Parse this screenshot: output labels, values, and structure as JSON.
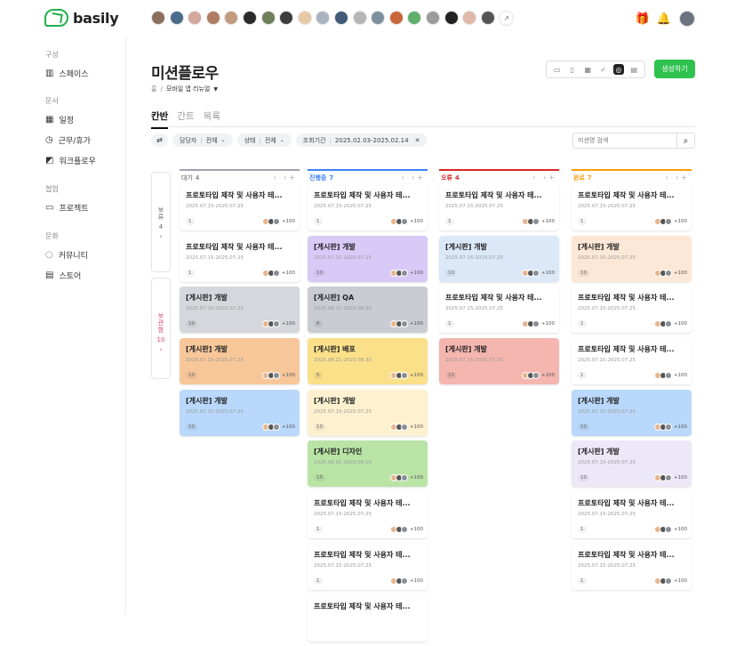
{
  "app": {
    "name": "basily"
  },
  "header": {
    "avatar_colors": [
      "#8b6f5c",
      "#4a6b8a",
      "#d4a89c",
      "#b07d62",
      "#c49a7e",
      "#2b2b2b",
      "#6e7f5a",
      "#3d3d3d",
      "#e8c9a6",
      "#aab4c0",
      "#405a78",
      "#b6b6b6",
      "#7b8f9c",
      "#c8663a",
      "#5fae6c",
      "#9c9c9c",
      "#222",
      "#e0b8a8",
      "#555"
    ]
  },
  "sidebar": {
    "sections": [
      {
        "label": "구성",
        "items": [
          {
            "label": "스페이스",
            "icon": "building-icon"
          }
        ]
      },
      {
        "label": "문서",
        "items": [
          {
            "label": "일정",
            "icon": "calendar-icon"
          },
          {
            "label": "근무/휴가",
            "icon": "clock-icon"
          },
          {
            "label": "워크플로우",
            "icon": "workflow-icon"
          }
        ]
      },
      {
        "label": "협업",
        "items": [
          {
            "label": "프로젝트",
            "icon": "folder-icon"
          }
        ]
      },
      {
        "label": "문화",
        "items": [
          {
            "label": "커뮤니티",
            "icon": "chat-icon"
          },
          {
            "label": "스토어",
            "icon": "store-icon"
          }
        ]
      }
    ]
  },
  "page": {
    "title": "미션플로우",
    "breadcrumb_home": "홈",
    "breadcrumb_sep": "/",
    "breadcrumb_current": "모바일 앱 리뉴얼",
    "create_label": "생성하기"
  },
  "tabs": [
    "칸반",
    "간트",
    "목록"
  ],
  "filters": {
    "assignee_label": "담당자",
    "assignee_value": "전체",
    "status_label": "상태",
    "status_value": "전체",
    "period_label": "조회기간",
    "period_value": "2025.02.03-2025.02.14",
    "search_placeholder": "미션명 검색"
  },
  "side_cols": [
    {
      "label": "보류",
      "count": "4"
    },
    {
      "label": "보관함",
      "count": "10"
    }
  ],
  "columns": [
    {
      "name": "대기",
      "count": "4",
      "color": "#9ca3af",
      "cards": [
        {
          "title": "프로토타입 제작 및 사용자 테...",
          "date": "2025.07.15-2025.07.25",
          "num": "1",
          "extra": "+100",
          "bg": "#ffffff"
        },
        {
          "title": "프로토타입 제작 및 사용자 테...",
          "date": "2025.07.15-2025.07.25",
          "num": "1",
          "extra": "+100",
          "bg": "#ffffff"
        },
        {
          "title": "[게시판] 개발",
          "date": "2025.07.15-2025.07.25",
          "num": "10",
          "extra": "+100",
          "bg": "#d5d7dc"
        },
        {
          "title": "[게시판] 개발",
          "date": "2025.07.15-2025.07.25",
          "num": "10",
          "extra": "+100",
          "bg": "#f7c79a"
        },
        {
          "title": "[게시판] 개발",
          "date": "2025.07.15-2025.07.25",
          "num": "10",
          "extra": "+100",
          "bg": "#b9d8fb"
        }
      ]
    },
    {
      "name": "진행중",
      "count": "7",
      "color": "#3b82f6",
      "cards": [
        {
          "title": "프로토타입 제작 및 사용자 테...",
          "date": "2025.07.15-2025.07.25",
          "num": "1",
          "extra": "+100",
          "bg": "#ffffff"
        },
        {
          "title": "[게시판] 개발",
          "date": "2025.07.15-2025.07.25",
          "num": "10",
          "extra": "+100",
          "bg": "#d9c9f7"
        },
        {
          "title": "[게시판] QA",
          "date": "2025.08.11-2025.08.20",
          "num": "8",
          "extra": "+100",
          "bg": "#c9ccd2"
        },
        {
          "title": "[게시판] 배포",
          "date": "2025.08.21-2025.08.30",
          "num": "5",
          "extra": "+100",
          "bg": "#fbe08a"
        },
        {
          "title": "[게시판] 개발",
          "date": "2025.07.15-2025.07.25",
          "num": "10",
          "extra": "+100",
          "bg": "#fdf1cf"
        },
        {
          "title": "[게시판] 디자인",
          "date": "2025.08.01-2025.08.10",
          "num": "15",
          "extra": "+100",
          "bg": "#b9e4a6"
        },
        {
          "title": "프로토타입 제작 및 사용자 테...",
          "date": "2025.07.15-2025.07.25",
          "num": "1",
          "extra": "+100",
          "bg": "#ffffff"
        },
        {
          "title": "프로토타입 제작 및 사용자 테...",
          "date": "2025.07.15-2025.07.25",
          "num": "1",
          "extra": "+100",
          "bg": "#ffffff"
        },
        {
          "title": "프로토타입 제작 및 사용자 테...",
          "date": "",
          "num": "",
          "extra": "",
          "bg": "#ffffff"
        }
      ]
    },
    {
      "name": "오류",
      "count": "4",
      "color": "#dc2626",
      "cards": [
        {
          "title": "프로토타입 제작 및 사용자 테...",
          "date": "2025.07.15-2025.07.25",
          "num": "1",
          "extra": "+100",
          "bg": "#ffffff"
        },
        {
          "title": "[게시판] 개발",
          "date": "2025.07.15-2025.07.25",
          "num": "10",
          "extra": "+100",
          "bg": "#dbe8f8"
        },
        {
          "title": "프로토타입 제작 및 사용자 테...",
          "date": "2025.07.15-2025.07.25",
          "num": "1",
          "extra": "+100",
          "bg": "#ffffff"
        },
        {
          "title": "[게시판] 개발",
          "date": "2025.07.15-2025.07.25",
          "num": "10",
          "extra": "+100",
          "bg": "#f5b6b0"
        }
      ]
    },
    {
      "name": "완료",
      "count": "7",
      "color": "#f59e0b",
      "cards": [
        {
          "title": "프로토타입 제작 및 사용자 테...",
          "date": "2025.07.15-2025.07.25",
          "num": "1",
          "extra": "+100",
          "bg": "#ffffff"
        },
        {
          "title": "[게시판] 개발",
          "date": "2025.07.15-2025.07.25",
          "num": "10",
          "extra": "+100",
          "bg": "#fde7d6"
        },
        {
          "title": "프로토타입 제작 및 사용자 테...",
          "date": "2025.07.15-2025.07.25",
          "num": "1",
          "extra": "+100",
          "bg": "#ffffff"
        },
        {
          "title": "프로토타입 제작 및 사용자 테...",
          "date": "2025.07.15-2025.07.25",
          "num": "1",
          "extra": "+100",
          "bg": "#ffffff"
        },
        {
          "title": "[게시판] 개발",
          "date": "2025.07.15-2025.07.25",
          "num": "10",
          "extra": "+100",
          "bg": "#b9d8fb"
        },
        {
          "title": "[게시판] 개발",
          "date": "2025.07.15-2025.07.25",
          "num": "10",
          "extra": "+100",
          "bg": "#ece8f8"
        },
        {
          "title": "프로토타입 제작 및 사용자 테...",
          "date": "2025.07.15-2025.07.25",
          "num": "1",
          "extra": "+100",
          "bg": "#ffffff"
        },
        {
          "title": "프로토타입 제작 및 사용자 테...",
          "date": "2025.07.15-2025.07.25",
          "num": "1",
          "extra": "+100",
          "bg": "#ffffff"
        }
      ]
    }
  ]
}
